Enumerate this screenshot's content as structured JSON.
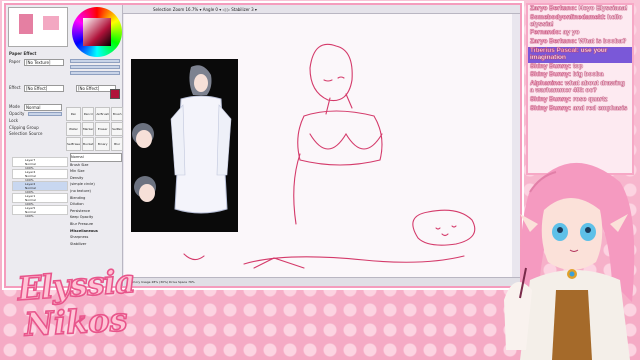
{
  "app": {
    "toolbar_text": "Selection   Zoom 16.7%   ▾   Angle 0   ▾   ◁ ▷   Stabilizer   3   ▾",
    "status_text": "Memory Usage 28% (30%)      Drive Space 76%",
    "left_panel": {
      "tab_effect": "Paper Effect",
      "texture_label": "Paper",
      "texture_value": "[No Texture]",
      "water_label": "Effect",
      "water_value": "[No Effect]",
      "blend_label": "Mode",
      "blend_value": "Normal",
      "opacity_label": "Opacity",
      "lock_label": "Lock",
      "clipping_label": "Clipping Group",
      "source_label": "Selection Source",
      "tools": [
        "Pen",
        "Pencil",
        "AirBrush",
        "Brush",
        "Water",
        "Marker",
        "Eraser",
        "SelPen",
        "SelErase",
        "Bucket",
        "Binary",
        "Blur"
      ],
      "layers": [
        {
          "name": "Layer7",
          "mode": "Normal",
          "pct": "100%"
        },
        {
          "name": "Layer4",
          "mode": "Normal",
          "pct": "100%"
        },
        {
          "name": "Layer2",
          "mode": "Normal",
          "pct": "100%"
        },
        {
          "name": "Layer1",
          "mode": "Normal",
          "pct": "100%"
        },
        {
          "name": "Layer5",
          "mode": "Normal",
          "pct": "100%"
        }
      ],
      "brush": {
        "mode": "Normal",
        "size_label": "Brush Size",
        "min_label": "Min Size",
        "density_label": "Density",
        "shape_label": "(simple circle)",
        "texture_label": "(no texture)",
        "blending_label": "Blending",
        "dilution_label": "Dilution",
        "persistence_label": "Persistence",
        "keep_opacity": "Keep Opacity",
        "blur_label": "Blur Pressure",
        "misc_label": "Miscellaneous",
        "sharpness_label": "Sharpness",
        "stabilizer_label": "Stabilizer"
      }
    }
  },
  "chat": [
    {
      "name": "Zaryo Berkano:",
      "text": "Heyo Elyssiaaa!",
      "highlight": false
    },
    {
      "name": "Somebodyonlinedamekl:",
      "text": "hello elyssia!",
      "highlight": false
    },
    {
      "name": "Fernando:",
      "text": "ay yo",
      "highlight": false
    },
    {
      "name": "Zaryo Berkano:",
      "text": "What is booba?",
      "highlight": false
    },
    {
      "name": "Tiberius Pascal:",
      "text": "use your imagination",
      "highlight": true
    },
    {
      "name": "Shiny Bunny:",
      "text": "top",
      "highlight": false
    },
    {
      "name": "Shiny Bunny:",
      "text": "big booba",
      "highlight": false
    },
    {
      "name": "Alphanine:",
      "text": "what about drawing a warhammer 40k oc?",
      "highlight": false
    },
    {
      "name": "Shiny Bunny:",
      "text": "rose quartz",
      "highlight": false
    },
    {
      "name": "Shiny Bunny:",
      "text": "and red emphasis",
      "highlight": false
    }
  ],
  "logo": {
    "line1": "Elyssia",
    "line2": "Nikos"
  },
  "colors": {
    "accent": "#f59cbd",
    "chat_highlight": "#7a58d8",
    "sketch": "#d43a6a"
  }
}
